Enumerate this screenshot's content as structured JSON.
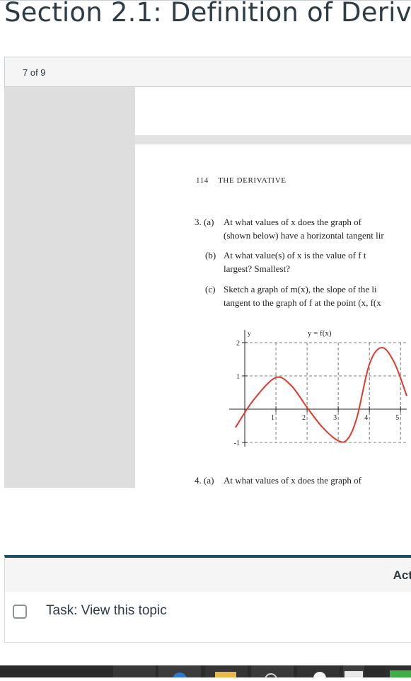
{
  "page_title": "Section 2.1: Definition of Deriv",
  "pager": {
    "label": "7 of 9"
  },
  "document": {
    "page_number": "114",
    "running_head": "THE DERIVATIVE",
    "problem3": {
      "a_label": "3. (a)",
      "a_line1": "At what values of x does the graph of",
      "a_line2": "(shown below) have a horizontal tangent lir",
      "b_label": "(b)",
      "b_line1": "At what value(s) of x is the value of f t",
      "b_line2": "largest? Smallest?",
      "c_label": "(c)",
      "c_line1": "Sketch a graph of m(x), the slope of the li",
      "c_line2": "tangent to the graph of f at the point (x, f(x"
    },
    "problem4": {
      "a_label": "4. (a)",
      "a_line1": "At what values of x does the graph of"
    }
  },
  "chart_data": {
    "type": "line",
    "title": "y = f(x)",
    "ylabel": "y",
    "xlim": [
      -0.5,
      5.2
    ],
    "ylim": [
      -1,
      2
    ],
    "x_ticks": [
      "1",
      "2",
      "3",
      "4",
      "5"
    ],
    "y_ticks": [
      "2",
      "1",
      "-1"
    ],
    "grid": true,
    "series": [
      {
        "color": "#e03a2c",
        "x": [
          -0.3,
          0.3,
          1.0,
          1.5,
          2.0,
          2.5,
          3.0,
          3.3,
          3.6,
          4.0,
          4.4,
          4.8,
          5.2
        ],
        "y": [
          -0.55,
          0.3,
          0.95,
          0.7,
          0.05,
          -0.55,
          -0.95,
          -0.9,
          -0.25,
          1.35,
          1.85,
          1.4,
          0.4
        ]
      }
    ]
  },
  "activity": {
    "header": "Act",
    "task_label": "Task: View this topic"
  }
}
